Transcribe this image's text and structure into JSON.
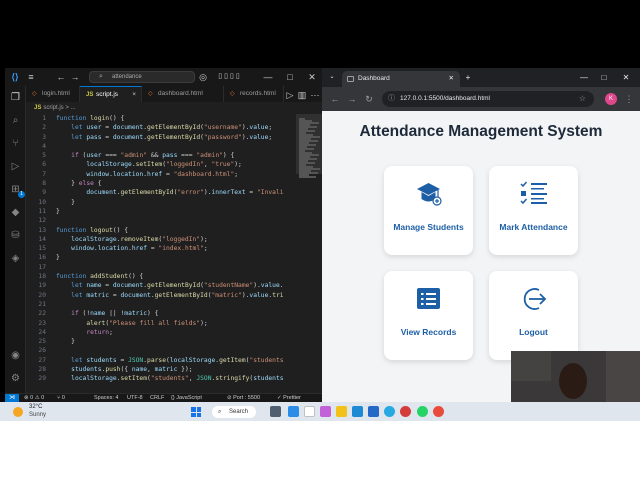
{
  "vscode": {
    "search_text": "attendance",
    "tabs": [
      {
        "label": "login.html",
        "type": "html"
      },
      {
        "label": "script.js",
        "type": "js",
        "active": true,
        "close": "×"
      },
      {
        "label": "dashboard.html",
        "type": "html"
      },
      {
        "label": "records.html",
        "type": "html"
      }
    ],
    "breadcrumb_file": "script.js",
    "breadcrumb_more": ">  ...",
    "code_lines": [
      {
        "n": "1",
        "html": "<span class='k'>function</span> <span class='f'>login</span>() {"
      },
      {
        "n": "2",
        "html": "    <span class='k'>let</span> <span class='v'>user</span> = <span class='v'>document</span>.<span class='f'>getElementById</span>(<span class='s'>\"username\"</span>).<span class='v'>value</span>;"
      },
      {
        "n": "3",
        "html": "    <span class='k'>let</span> <span class='v'>pass</span> = <span class='v'>document</span>.<span class='f'>getElementById</span>(<span class='s'>\"password\"</span>).<span class='v'>value</span>;"
      },
      {
        "n": "4",
        "html": ""
      },
      {
        "n": "5",
        "html": "    <span class='c'>if</span> (<span class='v'>user</span> === <span class='s'>\"admin\"</span> && <span class='v'>pass</span> === <span class='s'>\"admin\"</span>) {"
      },
      {
        "n": "6",
        "html": "        <span class='v'>localStorage</span>.<span class='f'>setItem</span>(<span class='s'>\"loggedIn\"</span>, <span class='s'>\"true\"</span>);"
      },
      {
        "n": "7",
        "html": "        <span class='v'>window</span>.<span class='v'>location</span>.<span class='v'>href</span> = <span class='s'>\"dashboard.html\"</span>;"
      },
      {
        "n": "8",
        "html": "    } <span class='c'>else</span> {"
      },
      {
        "n": "9",
        "html": "        <span class='v'>document</span>.<span class='f'>getElementById</span>(<span class='s'>\"error\"</span>).<span class='v'>innerText</span> = <span class='s'>\"Invali</span>"
      },
      {
        "n": "10",
        "html": "    }"
      },
      {
        "n": "11",
        "html": "}"
      },
      {
        "n": "12",
        "html": ""
      },
      {
        "n": "13",
        "html": "<span class='k'>function</span> <span class='f'>logout</span>() {"
      },
      {
        "n": "14",
        "html": "    <span class='v'>localStorage</span>.<span class='f'>removeItem</span>(<span class='s'>\"loggedIn\"</span>);"
      },
      {
        "n": "15",
        "html": "    <span class='v'>window</span>.<span class='v'>location</span>.<span class='v'>href</span> = <span class='s'>\"index.html\"</span>;"
      },
      {
        "n": "16",
        "html": "}"
      },
      {
        "n": "17",
        "html": ""
      },
      {
        "n": "18",
        "html": "<span class='k'>function</span> <span class='f'>addStudent</span>() {"
      },
      {
        "n": "19",
        "html": "    <span class='k'>let</span> <span class='v'>name</span> = <span class='v'>document</span>.<span class='f'>getElementById</span>(<span class='s'>\"studentName\"</span>).<span class='v'>value</span>."
      },
      {
        "n": "20",
        "html": "    <span class='k'>let</span> <span class='v'>matric</span> = <span class='v'>document</span>.<span class='f'>getElementById</span>(<span class='s'>\"matric\"</span>).<span class='v'>value</span>.<span class='f'>tri</span>"
      },
      {
        "n": "21",
        "html": ""
      },
      {
        "n": "22",
        "html": "    <span class='c'>if</span> (!<span class='v'>name</span> || !<span class='v'>matric</span>) {"
      },
      {
        "n": "23",
        "html": "        <span class='f'>alert</span>(<span class='s'>\"Please fill all fields\"</span>);"
      },
      {
        "n": "24",
        "html": "        <span class='c'>return</span>;"
      },
      {
        "n": "25",
        "html": "    }"
      },
      {
        "n": "26",
        "html": ""
      },
      {
        "n": "27",
        "html": "    <span class='k'>let</span> <span class='v'>students</span> = <span class='o'>JSON</span>.<span class='f'>parse</span>(<span class='v'>localStorage</span>.<span class='f'>getItem</span>(<span class='s'>\"students</span>"
      },
      {
        "n": "28",
        "html": "    <span class='v'>students</span>.<span class='f'>push</span>({ <span class='v'>name</span>, <span class='v'>matric</span> });"
      },
      {
        "n": "29",
        "html": "    <span class='v'>localStorage</span>.<span class='f'>setItem</span>(<span class='s'>\"students\"</span>, <span class='o'>JSON</span>.<span class='f'>stringify</span>(<span class='v'>students</span>"
      }
    ],
    "status": {
      "problems": "⊗ 0 ⚠ 0",
      "ports": "⑂ 0",
      "spaces": "Spaces: 4",
      "encoding": "UTF-8",
      "eol": "CRLF",
      "language": "{} JavaScript",
      "port": "⊘ Port : 5500",
      "prettier": "✓ Prettier"
    }
  },
  "browser": {
    "tab_title": "Dashboard",
    "url": "127.0.0.1:5500/dashboard.html",
    "avatar": "K",
    "page": {
      "title": "Attendance Management System",
      "cards": [
        {
          "label": "Manage Students",
          "icon": "graduation-cap-icon"
        },
        {
          "label": "Mark Attendance",
          "icon": "checklist-icon"
        },
        {
          "label": "View Records",
          "icon": "list-document-icon"
        },
        {
          "label": "Logout",
          "icon": "logout-arrow-icon"
        }
      ],
      "accent": "#1d5fa6"
    }
  },
  "taskbar": {
    "temperature": "32°C",
    "weather": "Sunny",
    "search_label": "Search"
  }
}
